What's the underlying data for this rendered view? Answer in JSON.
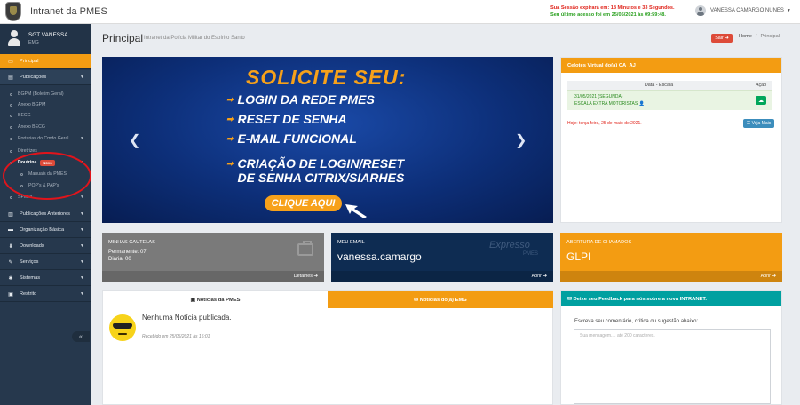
{
  "app": {
    "title": "Intranet da PMES"
  },
  "session": {
    "line1": "Sua Sessão expirará em: 18 Minutos e 33 Segundos.",
    "line2": "Seu último acesso foi em 25/05/2021 às 09:59:48."
  },
  "user": {
    "name": "VANESSA CAMARGO NUNES"
  },
  "profile": {
    "name": "SGT VANESSA",
    "role": "EMG"
  },
  "sidebar": {
    "items": [
      {
        "label": "Principal",
        "icon": "monitor-icon"
      },
      {
        "label": "Publicações",
        "icon": "book-icon"
      },
      {
        "label": "Publicações Anteriores",
        "icon": "columns-icon"
      },
      {
        "label": "Organização Básica",
        "icon": "laptop-icon"
      },
      {
        "label": "Downloads",
        "icon": "download-icon"
      },
      {
        "label": "Serviços",
        "icon": "wrench-icon"
      },
      {
        "label": "Sistemas",
        "icon": "gear-icon"
      },
      {
        "label": "Restrito",
        "icon": "lock-icon"
      }
    ],
    "sub_items": [
      "BGPM (Boletim Geral)",
      "Anexo BGPM",
      "BECG",
      "Anexo BECG",
      "Portarias do Cmdo Geral",
      "Diretrizes",
      "Doutrina",
      "Manuais da PMES",
      "POP's & PAP's",
      "SPMPC"
    ],
    "badge": "Novo"
  },
  "header": {
    "title": "Principal",
    "subtitle": "Intranet da Polícia Militar do Espírito Santo",
    "sair": "Sair",
    "breadcrumb_home": "Home",
    "breadcrumb_current": "Principal"
  },
  "carousel": {
    "heading": "SOLICITE SEU:",
    "items": [
      "LOGIN DA REDE PMES",
      "RESET DE SENHA",
      "E-MAIL FUNCIONAL",
      "CRIAÇÃO DE LOGIN/RESET",
      "DE SENHA CITRIX/SIARHES"
    ],
    "cta": "CLIQUE AQUI"
  },
  "celotes": {
    "title": "Celotes Virtual do(a) CA_AJ",
    "col_data": "Data - Escala",
    "col_acao": "Ação",
    "row_date": "31/05/2021 (SEGUNDA)",
    "row_escala": "ESCALA EXTRA MOTORISTAS",
    "hoje": "Hoje: terça feira, 25 de maio de 2021.",
    "veja_mais": "Veja Mais"
  },
  "boxes": {
    "cautelas": {
      "title": "MINHAS CAUTELAS",
      "permanente": "Permanente: 07",
      "diaria": "Diária: 00",
      "footer": "Detalhes"
    },
    "email": {
      "title": "MEU EMAIL",
      "value": "vanessa.camargo",
      "brand": "Expresso",
      "brand_sub": "PMES",
      "footer": "Abrir"
    },
    "chamados": {
      "title": "ABERTURA DE CHAMADOS",
      "value": "GLPI",
      "footer": "Abrir"
    }
  },
  "news": {
    "tab1": "Notícias da PMES",
    "tab2": "Notícias do(a) EMG",
    "empty": "Nenhuma Notícia publicada.",
    "received": "Recebido em 25/05/2021 às 15:01"
  },
  "feedback": {
    "title": "Deixe seu Feedback para nós sobre a nova INTRANET.",
    "label": "Escreva seu comentário, crítica ou sugestão abaixo:",
    "placeholder": "Sua mensagem.... até 200 caracteres."
  },
  "colors": {
    "accent": "#f39c12",
    "sidebar": "#26384d",
    "teal": "#00a0a0",
    "danger": "#dd4b39"
  }
}
